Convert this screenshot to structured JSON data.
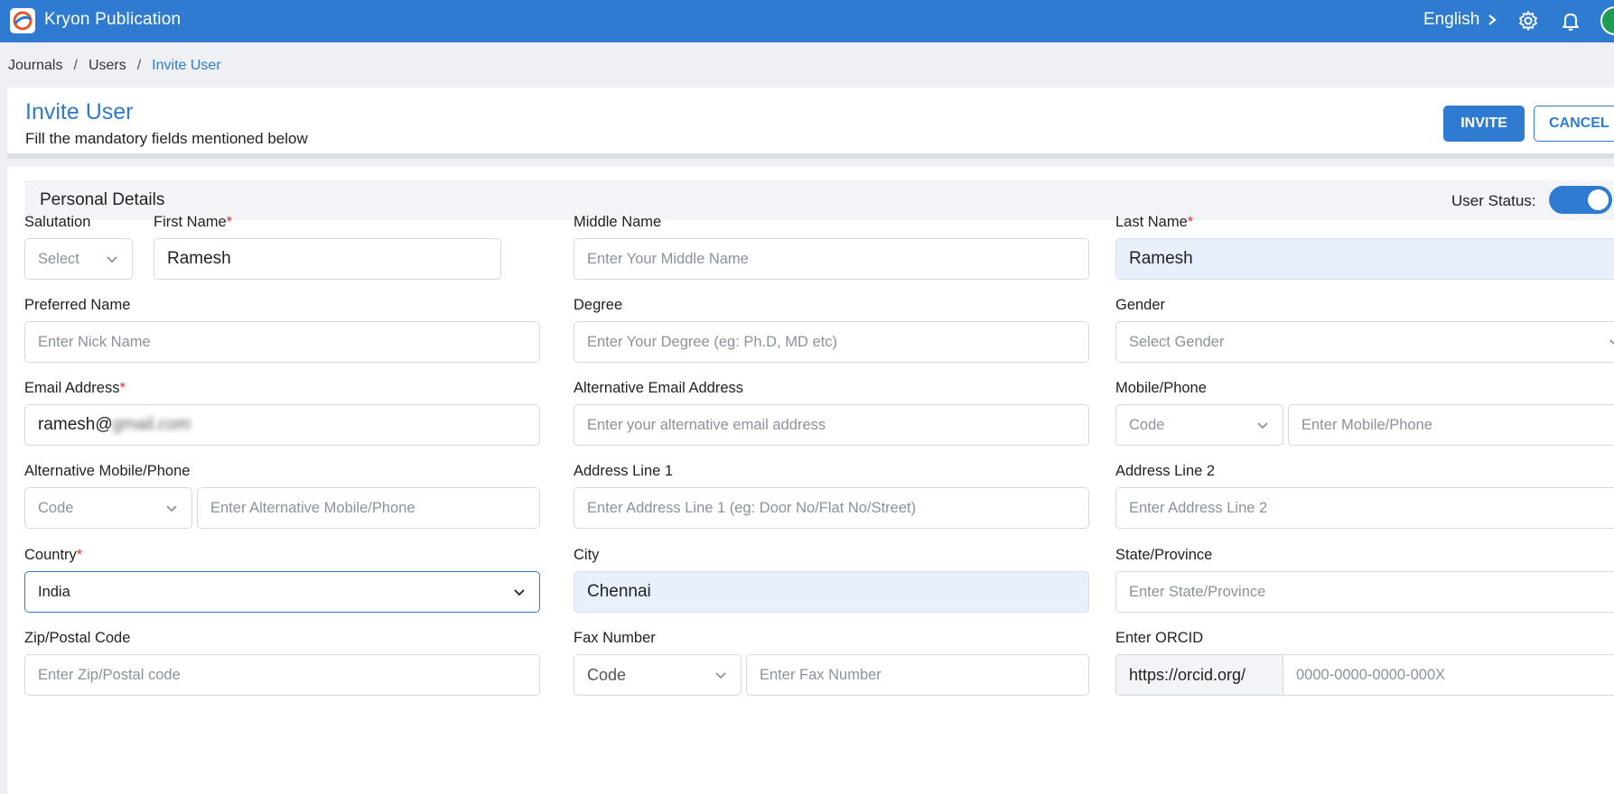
{
  "app": {
    "title": "Kryon Publication",
    "language": "English"
  },
  "breadcrumb": {
    "items": [
      "Journals",
      "Users"
    ],
    "current": "Invite User",
    "separator": "/"
  },
  "header": {
    "title": "Invite User",
    "subtitle": "Fill the mandatory fields mentioned below",
    "invite_label": "INVITE",
    "cancel_label": "CANCEL"
  },
  "section": {
    "title": "Personal Details",
    "user_status_label": "User Status:",
    "user_status_on": true
  },
  "form": {
    "salutation": {
      "label": "Salutation",
      "value": "Select"
    },
    "first_name": {
      "label": "First Name",
      "required": "*",
      "value": "Ramesh"
    },
    "middle_name": {
      "label": "Middle Name",
      "placeholder": "Enter Your Middle Name"
    },
    "last_name": {
      "label": "Last Name",
      "required": "*",
      "value": "Ramesh"
    },
    "preferred_name": {
      "label": "Preferred Name",
      "placeholder": "Enter Nick Name"
    },
    "degree": {
      "label": "Degree",
      "placeholder": "Enter Your Degree (eg: Ph.D, MD etc)"
    },
    "gender": {
      "label": "Gender",
      "placeholder": "Select Gender"
    },
    "email": {
      "label": "Email Address",
      "required": "*",
      "value": "ramesh@",
      "value_obscured": "gmail.com"
    },
    "alt_email": {
      "label": "Alternative Email Address",
      "placeholder": "Enter your alternative email address"
    },
    "mobile": {
      "label": "Mobile/Phone",
      "code_placeholder": "Code",
      "placeholder": "Enter Mobile/Phone"
    },
    "alt_mobile": {
      "label": "Alternative Mobile/Phone",
      "code_placeholder": "Code",
      "placeholder": "Enter Alternative Mobile/Phone"
    },
    "address1": {
      "label": "Address Line 1",
      "placeholder": "Enter Address Line 1 (eg: Door No/Flat No/Street)"
    },
    "address2": {
      "label": "Address Line 2",
      "placeholder": "Enter Address Line 2"
    },
    "country": {
      "label": "Country",
      "required": "*",
      "value": "India"
    },
    "city": {
      "label": "City",
      "value": "Chennai"
    },
    "state": {
      "label": "State/Province",
      "placeholder": "Enter State/Province"
    },
    "zip": {
      "label": "Zip/Postal Code",
      "placeholder": "Enter Zip/Postal code"
    },
    "fax": {
      "label": "Fax Number",
      "code_placeholder": "Code",
      "placeholder": "Enter Fax Number"
    },
    "orcid": {
      "label": "Enter ORCID",
      "prefix": "https://orcid.org/",
      "placeholder": "0000-0000-0000-000X"
    }
  },
  "colors": {
    "primary": "#2f7bd1",
    "required": "#e03131",
    "filled_bg": "#e8f0fc"
  }
}
